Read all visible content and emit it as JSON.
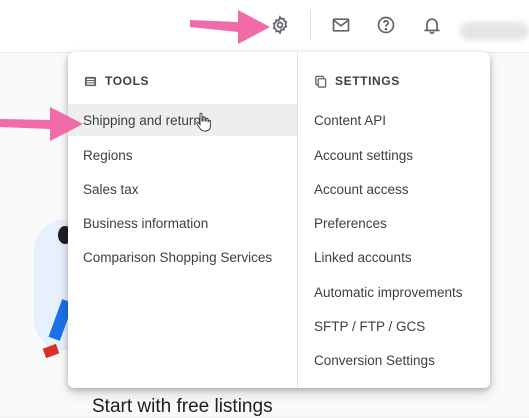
{
  "topbar": {
    "icons": [
      "gear-icon",
      "mail-icon",
      "help-icon",
      "bell-icon"
    ]
  },
  "menu": {
    "tools": {
      "heading": "TOOLS",
      "icon": "tools-icon",
      "items": [
        {
          "label": "Shipping and returns",
          "hovered": true
        },
        {
          "label": "Regions"
        },
        {
          "label": "Sales tax"
        },
        {
          "label": "Business information"
        },
        {
          "label": "Comparison Shopping Services"
        }
      ]
    },
    "settings": {
      "heading": "SETTINGS",
      "icon": "settings-icon",
      "items": [
        {
          "label": "Content API"
        },
        {
          "label": "Account settings"
        },
        {
          "label": "Account access"
        },
        {
          "label": "Preferences"
        },
        {
          "label": "Linked accounts"
        },
        {
          "label": "Automatic improvements"
        },
        {
          "label": "SFTP / FTP / GCS"
        },
        {
          "label": "Conversion Settings"
        }
      ]
    }
  },
  "page": {
    "title": "Start with free listings"
  },
  "colors": {
    "annotation_arrow": "#f06ba8",
    "hover_bg": "#eeeeee",
    "text": "#3c4043"
  }
}
